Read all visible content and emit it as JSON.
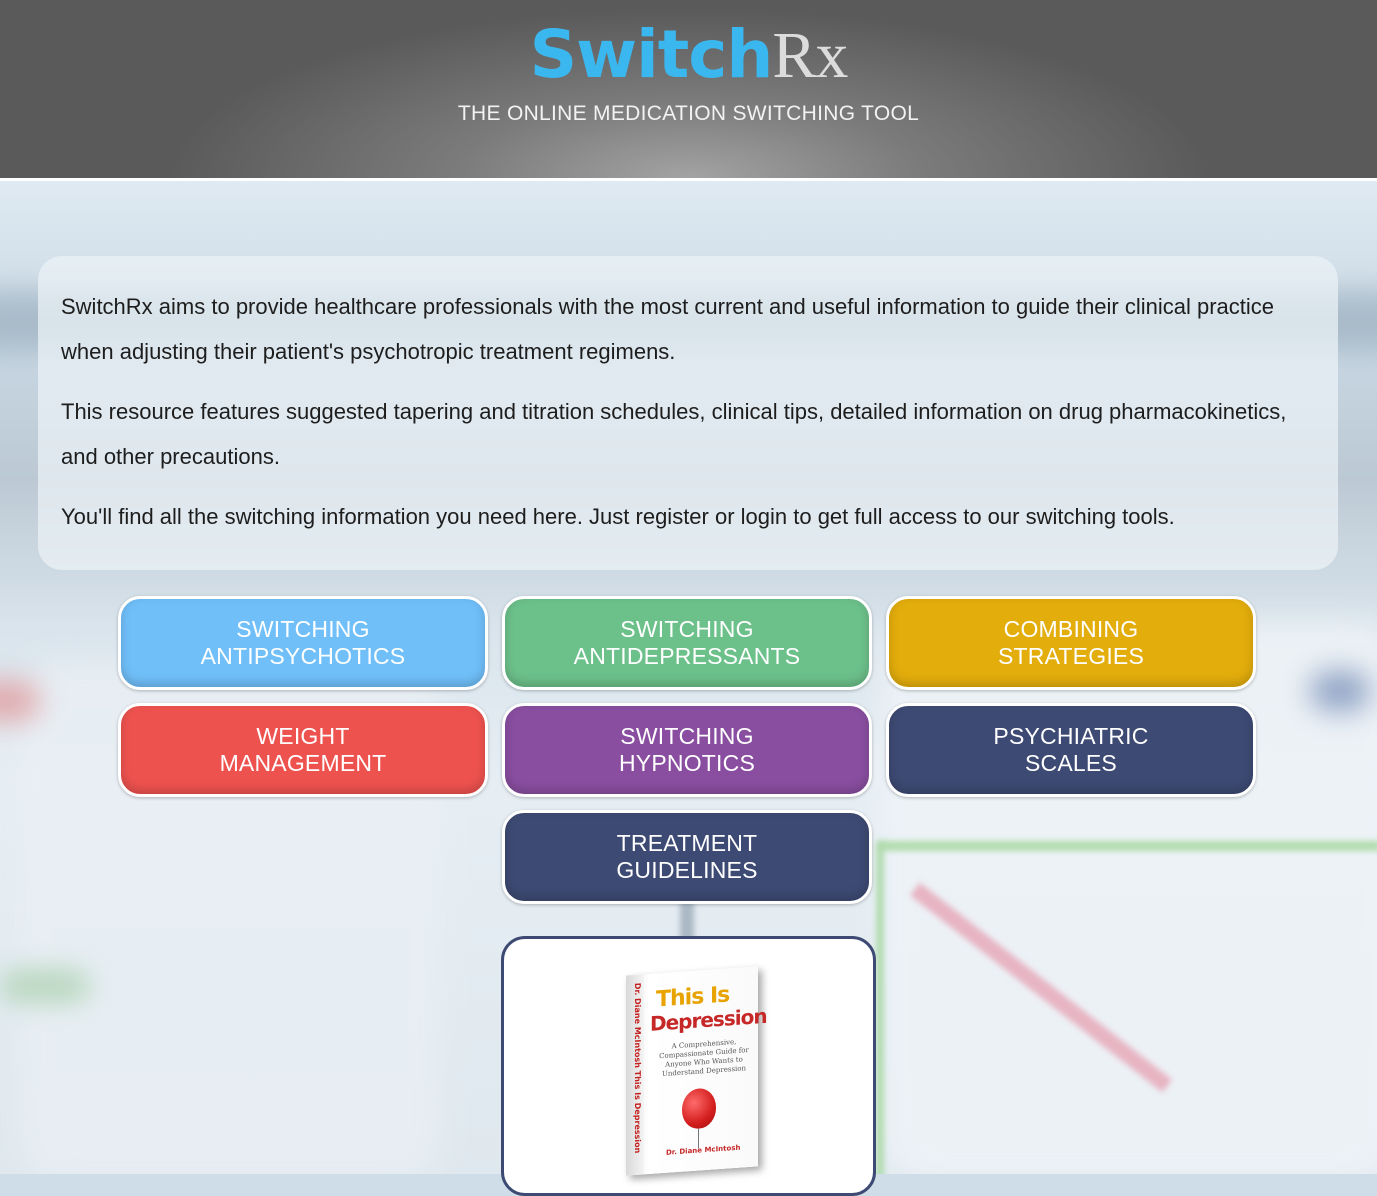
{
  "header": {
    "logo_part1": "Switch",
    "logo_part2": "Rx",
    "tagline": "THE ONLINE MEDICATION SWITCHING TOOL",
    "logo_colors": {
      "switch": "#3bb7ef",
      "rx": "#dcdcdc"
    }
  },
  "intro": {
    "paragraphs": [
      "SwitchRx aims to provide healthcare professionals with the most current and useful information to guide their clinical practice when adjusting their patient's psychotropic treatment regimens.",
      "This resource features suggested tapering and titration schedules, clinical tips, detailed information on drug pharmacokinetics, and other precautions.",
      "You'll find all the switching information you need here. Just register or login to get full access to our switching tools."
    ]
  },
  "buttons": [
    {
      "label": "SWITCHING\nANTIPSYCHOTICS",
      "color": "#70bff9"
    },
    {
      "label": "SWITCHING\nANTIDEPRESSANTS",
      "color": "#6cc08a"
    },
    {
      "label": "COMBINING\nSTRATEGIES",
      "color": "#e3ad0c"
    },
    {
      "label": "WEIGHT\nMANAGEMENT",
      "color": "#ee524f"
    },
    {
      "label": "SWITCHING\nHYPNOTICS",
      "color": "#894ea0"
    },
    {
      "label": "PSYCHIATRIC\nSCALES",
      "color": "#3d4a73"
    },
    {
      "label": "TREATMENT\nGUIDELINES",
      "color": "#3d4a73"
    }
  ],
  "book": {
    "title_line1": "This Is",
    "title_line2": "Depression",
    "subtitle": "A Comprehensive, Compassionate Guide for Anyone Who Wants to Understand Depression",
    "author": "Dr. Diane McIntosh",
    "spine": "Dr. Diane McIntosh  This Is Depression"
  }
}
